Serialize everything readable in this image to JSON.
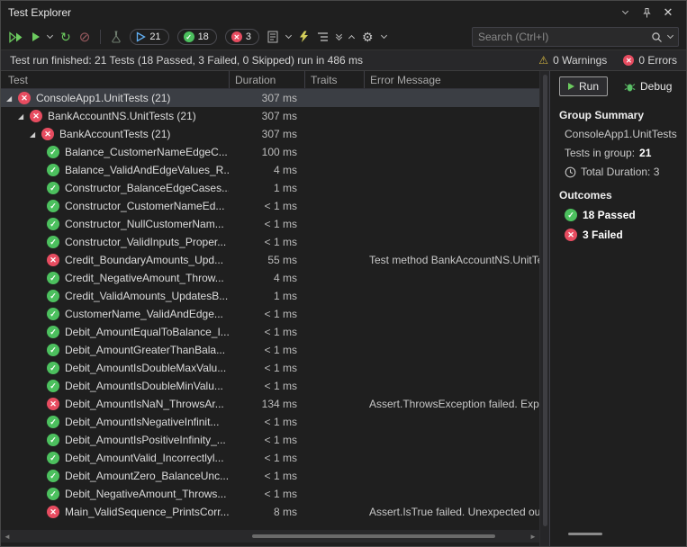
{
  "window": {
    "title": "Test Explorer"
  },
  "toolbar": {
    "badges": {
      "total": "21",
      "passed": "18",
      "failed": "3"
    },
    "search": {
      "placeholder": "Search (Ctrl+I)"
    }
  },
  "status_bar": {
    "message": "Test run finished: 21 Tests (18 Passed, 3 Failed, 0 Skipped) run in 486 ms",
    "warnings": "0 Warnings",
    "errors": "0 Errors"
  },
  "colors": {
    "passed_green": "#4cc05e",
    "failed_red": "#e74c60",
    "run_green": "#6ccb5f",
    "warning_yellow": "#d6b740",
    "badge_play_blue": "#61aef2",
    "lightning_yellow": "#d4cf5a"
  },
  "table": {
    "columns": [
      "Test",
      "Duration",
      "Traits",
      "Error Message"
    ],
    "rows": [
      {
        "level": 0,
        "expand": true,
        "status": "failed",
        "name": "ConsoleApp1.UnitTests (21)",
        "duration": "307 ms",
        "error": "",
        "selected": true
      },
      {
        "level": 1,
        "expand": true,
        "status": "failed",
        "name": "BankAccountNS.UnitTests (21)",
        "duration": "307 ms",
        "error": ""
      },
      {
        "level": 2,
        "expand": true,
        "status": "failed",
        "name": "BankAccountTests (21)",
        "duration": "307 ms",
        "error": ""
      },
      {
        "level": 3,
        "status": "passed",
        "name": "Balance_CustomerNameEdgeC...",
        "duration": "100 ms",
        "error": ""
      },
      {
        "level": 3,
        "status": "passed",
        "name": "Balance_ValidAndEdgeValues_R...",
        "duration": "4 ms",
        "error": ""
      },
      {
        "level": 3,
        "status": "passed",
        "name": "Constructor_BalanceEdgeCases...",
        "duration": "1 ms",
        "error": ""
      },
      {
        "level": 3,
        "status": "passed",
        "name": "Constructor_CustomerNameEd...",
        "duration": "< 1 ms",
        "error": ""
      },
      {
        "level": 3,
        "status": "passed",
        "name": "Constructor_NullCustomerNam...",
        "duration": "< 1 ms",
        "error": ""
      },
      {
        "level": 3,
        "status": "passed",
        "name": "Constructor_ValidInputs_Proper...",
        "duration": "< 1 ms",
        "error": ""
      },
      {
        "level": 3,
        "status": "failed",
        "name": "Credit_BoundaryAmounts_Upd...",
        "duration": "55 ms",
        "error": "Test method BankAccountNS.UnitTest"
      },
      {
        "level": 3,
        "status": "passed",
        "name": "Credit_NegativeAmount_Throw...",
        "duration": "4 ms",
        "error": ""
      },
      {
        "level": 3,
        "status": "passed",
        "name": "Credit_ValidAmounts_UpdatesB...",
        "duration": "1 ms",
        "error": ""
      },
      {
        "level": 3,
        "status": "passed",
        "name": "CustomerName_ValidAndEdge...",
        "duration": "< 1 ms",
        "error": ""
      },
      {
        "level": 3,
        "status": "passed",
        "name": "Debit_AmountEqualToBalance_I...",
        "duration": "< 1 ms",
        "error": ""
      },
      {
        "level": 3,
        "status": "passed",
        "name": "Debit_AmountGreaterThanBala...",
        "duration": "< 1 ms",
        "error": ""
      },
      {
        "level": 3,
        "status": "passed",
        "name": "Debit_AmountIsDoubleMaxValu...",
        "duration": "< 1 ms",
        "error": ""
      },
      {
        "level": 3,
        "status": "passed",
        "name": "Debit_AmountIsDoubleMinValu...",
        "duration": "< 1 ms",
        "error": ""
      },
      {
        "level": 3,
        "status": "failed",
        "name": "Debit_AmountIsNaN_ThrowsAr...",
        "duration": "134 ms",
        "error": "Assert.ThrowsException failed. Expect"
      },
      {
        "level": 3,
        "status": "passed",
        "name": "Debit_AmountIsNegativeInfinit...",
        "duration": "< 1 ms",
        "error": ""
      },
      {
        "level": 3,
        "status": "passed",
        "name": "Debit_AmountIsPositiveInfinity_...",
        "duration": "< 1 ms",
        "error": ""
      },
      {
        "level": 3,
        "status": "passed",
        "name": "Debit_AmountValid_Incorrectlyl...",
        "duration": "< 1 ms",
        "error": ""
      },
      {
        "level": 3,
        "status": "passed",
        "name": "Debit_AmountZero_BalanceUnc...",
        "duration": "< 1 ms",
        "error": ""
      },
      {
        "level": 3,
        "status": "passed",
        "name": "Debit_NegativeAmount_Throws...",
        "duration": "< 1 ms",
        "error": ""
      },
      {
        "level": 3,
        "status": "failed",
        "name": "Main_ValidSequence_PrintsCorr...",
        "duration": "8 ms",
        "error": "Assert.IsTrue failed. Unexpected outp"
      }
    ]
  },
  "details": {
    "run_label": "Run",
    "debug_label": "Debug",
    "group_summary_title": "Group Summary",
    "group_name": "ConsoleApp1.UnitTests",
    "tests_in_group_label": "Tests in group:",
    "tests_in_group_value": "21",
    "total_duration": "Total Duration: 3",
    "outcomes_title": "Outcomes",
    "passed_label": "18 Passed",
    "failed_label": "3 Failed"
  }
}
